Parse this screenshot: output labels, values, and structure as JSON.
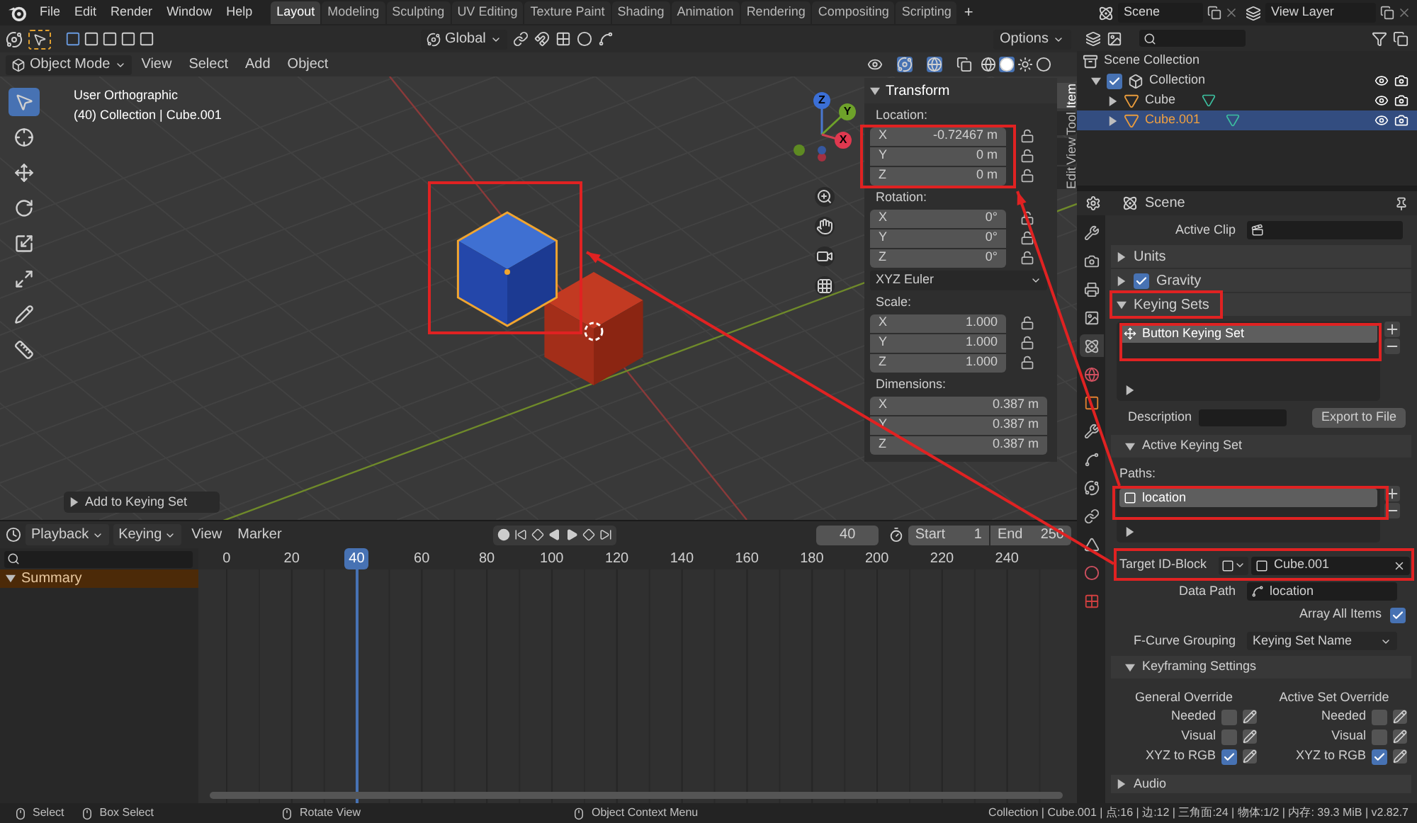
{
  "topbar": {
    "menus": [
      "File",
      "Edit",
      "Render",
      "Window",
      "Help"
    ],
    "workspaces": [
      {
        "label": "Layout",
        "selected": true
      },
      {
        "label": "Modeling",
        "selected": false
      },
      {
        "label": "Sculpting",
        "selected": false
      },
      {
        "label": "UV Editing",
        "selected": false
      },
      {
        "label": "Texture Paint",
        "selected": false
      },
      {
        "label": "Shading",
        "selected": false
      },
      {
        "label": "Animation",
        "selected": false
      },
      {
        "label": "Rendering",
        "selected": false
      },
      {
        "label": "Compositing",
        "selected": false
      },
      {
        "label": "Scripting",
        "selected": false
      }
    ],
    "add_tab": "+",
    "scene": "Scene",
    "view_layer": "View Layer"
  },
  "viewport": {
    "orientation": "Global",
    "options": "Options",
    "mode": "Object Mode",
    "menus": [
      "View",
      "Select",
      "Add",
      "Object"
    ],
    "overlay_text": [
      "User Orthographic",
      "(40) Collection | Cube.001"
    ],
    "gizmo": {
      "z": "Z",
      "y": "Y",
      "x": "X"
    },
    "operator_panel": "Add to Keying Set"
  },
  "n_panel": {
    "tabs": [
      {
        "label": "Item",
        "selected": true
      },
      {
        "label": "Tool",
        "selected": false
      },
      {
        "label": "View",
        "selected": false
      },
      {
        "label": "Edit",
        "selected": false
      }
    ],
    "title": "Transform",
    "groups": [
      {
        "label": "Location:",
        "kind": "lockable",
        "fields": [
          {
            "axis": "X",
            "value": "-0.72467 m"
          },
          {
            "axis": "Y",
            "value": "0 m"
          },
          {
            "axis": "Z",
            "value": "0 m"
          }
        ]
      },
      {
        "label": "Rotation:",
        "kind": "lockable",
        "fields": [
          {
            "axis": "X",
            "value": "0°"
          },
          {
            "axis": "Y",
            "value": "0°"
          },
          {
            "axis": "Z",
            "value": "0°"
          }
        ],
        "mode": "XYZ Euler"
      },
      {
        "label": "Scale:",
        "kind": "lockable",
        "fields": [
          {
            "axis": "X",
            "value": "1.000"
          },
          {
            "axis": "Y",
            "value": "1.000"
          },
          {
            "axis": "Z",
            "value": "1.000"
          }
        ]
      },
      {
        "label": "Dimensions:",
        "kind": "plain",
        "fields": [
          {
            "axis": "X",
            "value": "0.387 m"
          },
          {
            "axis": "Y",
            "value": "0.387 m"
          },
          {
            "axis": "Z",
            "value": "0.387 m"
          }
        ]
      }
    ]
  },
  "outliner": {
    "items": [
      {
        "label": "Scene Collection",
        "kind": "scene_collection",
        "selected": false,
        "children": [
          {
            "label": "Collection",
            "kind": "collection",
            "selected": false,
            "expanded": true,
            "checked": true,
            "children": [
              {
                "label": "Cube",
                "kind": "object",
                "selected": false,
                "expanded": false
              },
              {
                "label": "Cube.001",
                "kind": "object",
                "selected": true,
                "expanded": false
              }
            ]
          }
        ]
      }
    ]
  },
  "properties": {
    "context": "Scene",
    "tabs": [
      {
        "kind": "tool",
        "selected": false
      },
      {
        "kind": "render",
        "selected": false
      },
      {
        "kind": "output",
        "selected": false
      },
      {
        "kind": "view_layer",
        "selected": false
      },
      {
        "kind": "scene",
        "selected": true
      },
      {
        "kind": "world",
        "selected": false
      },
      {
        "kind": "object",
        "selected": false
      },
      {
        "kind": "modifiers",
        "selected": false
      },
      {
        "kind": "particles",
        "selected": false
      },
      {
        "kind": "physics",
        "selected": false
      },
      {
        "kind": "constraints",
        "selected": false
      },
      {
        "kind": "data",
        "selected": false
      },
      {
        "kind": "material",
        "selected": false
      },
      {
        "kind": "texture",
        "selected": false
      }
    ],
    "active_clip_label": "Active Clip",
    "panels": [
      {
        "title": "Units",
        "expanded": false
      },
      {
        "title": "Gravity",
        "expanded": false,
        "checked": true
      },
      {
        "title": "Keying Sets",
        "expanded": true
      }
    ],
    "keying_sets": [
      {
        "label": "Button Keying Set",
        "selected": true
      }
    ],
    "description_label": "Description",
    "export_button": "Export to File",
    "active_keying_set": {
      "title": "Active Keying Set",
      "expanded": true,
      "paths_label": "Paths:",
      "paths": [
        {
          "label": "location",
          "selected": true
        }
      ],
      "target_label": "Target ID-Block",
      "target_value": "Cube.001",
      "data_path_label": "Data Path",
      "data_path_value": "location",
      "array_all": {
        "label": "Array All Items",
        "checked": true
      },
      "grouping_label": "F-Curve Grouping",
      "grouping_value": "Keying Set Name"
    },
    "keyframing": {
      "title": "Keyframing Settings",
      "expanded": true,
      "columns": [
        {
          "title": "General Override",
          "options": [
            {
              "label": "Needed",
              "checked": false
            },
            {
              "label": "Visual",
              "checked": false
            },
            {
              "label": "XYZ to RGB",
              "checked": true
            }
          ]
        },
        {
          "title": "Active Set Override",
          "options": [
            {
              "label": "Needed",
              "checked": false
            },
            {
              "label": "Visual",
              "checked": false
            },
            {
              "label": "XYZ to RGB",
              "checked": true
            }
          ]
        }
      ]
    },
    "audio": {
      "title": "Audio",
      "expanded": false
    }
  },
  "timeline": {
    "menus": [
      "Playback",
      "Keying",
      "View",
      "Marker"
    ],
    "current_frame": "40",
    "start_label": "Start",
    "start": "1",
    "end_label": "End",
    "end": "250",
    "ticks": [
      {
        "label": "0",
        "selected": false
      },
      {
        "label": "20",
        "selected": false
      },
      {
        "label": "40",
        "selected": true
      },
      {
        "label": "60",
        "selected": false
      },
      {
        "label": "80",
        "selected": false
      },
      {
        "label": "100",
        "selected": false
      },
      {
        "label": "120",
        "selected": false
      },
      {
        "label": "140",
        "selected": false
      },
      {
        "label": "160",
        "selected": false
      },
      {
        "label": "180",
        "selected": false
      },
      {
        "label": "200",
        "selected": false
      },
      {
        "label": "220",
        "selected": false
      },
      {
        "label": "240",
        "selected": false
      }
    ],
    "channels": [
      {
        "label": "Summary",
        "expanded": true
      }
    ]
  },
  "status_bar": {
    "hints": [
      "Select",
      "Box Select",
      "Rotate View",
      "Object Context Menu"
    ],
    "info": "Collection | Cube.001 | 点:16 | 边:12 | 三角面:24 | 物体:1/2 | 内存: 39.3 MiB | v2.82.7"
  }
}
